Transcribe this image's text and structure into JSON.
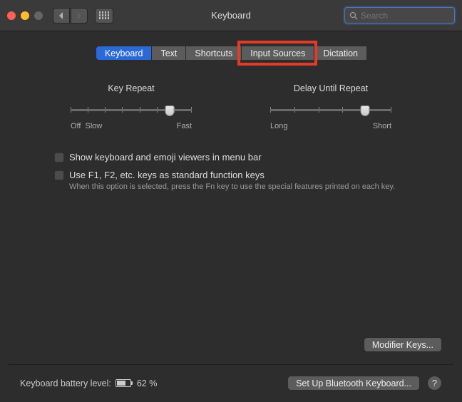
{
  "window": {
    "title": "Keyboard"
  },
  "search": {
    "placeholder": "Search"
  },
  "tabs": [
    "Keyboard",
    "Text",
    "Shortcuts",
    "Input Sources",
    "Dictation"
  ],
  "sliders": {
    "key_repeat": {
      "label": "Key Repeat",
      "left": "Off",
      "left2": "Slow",
      "right": "Fast",
      "ticks": 8,
      "value_pct": 82
    },
    "delay": {
      "label": "Delay Until Repeat",
      "left": "Long",
      "right": "Short",
      "ticks": 6,
      "value_pct": 78
    }
  },
  "options": {
    "show_viewers": "Show keyboard and emoji viewers in menu bar",
    "fn_keys": "Use F1, F2, etc. keys as standard function keys",
    "fn_sub": "When this option is selected, press the Fn key to use the special features printed on each key."
  },
  "buttons": {
    "modifier": "Modifier Keys...",
    "bluetooth": "Set Up Bluetooth Keyboard..."
  },
  "battery": {
    "label": "Keyboard battery level:",
    "value": "62 %"
  }
}
